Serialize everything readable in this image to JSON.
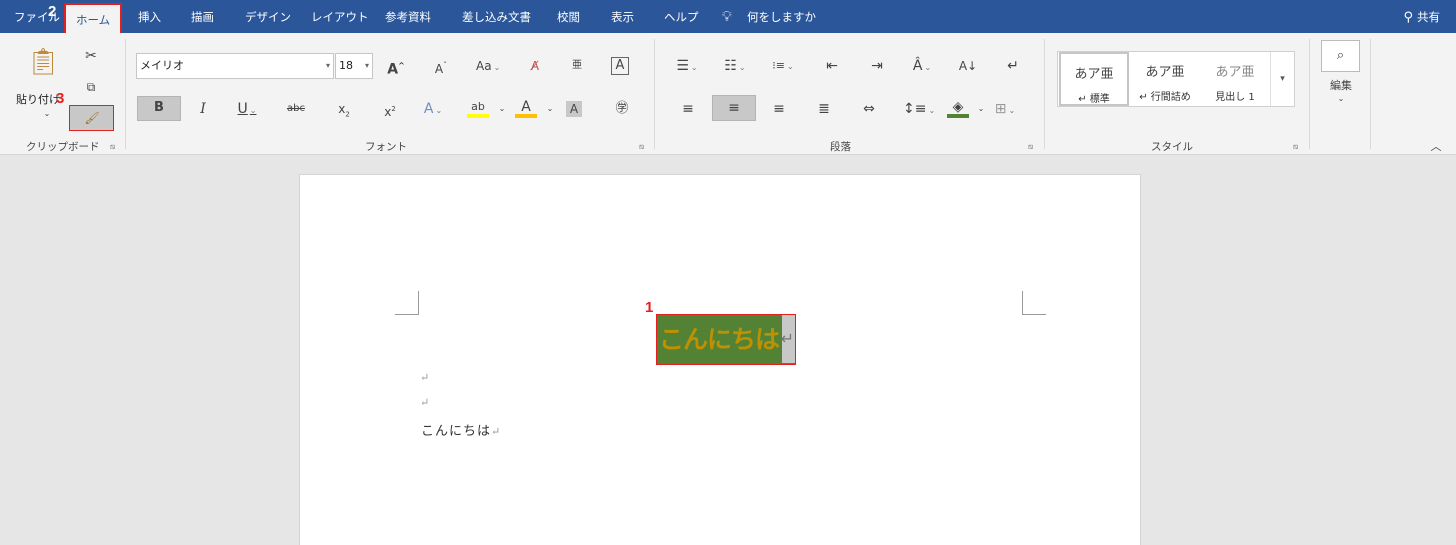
{
  "tabs": {
    "file": "ファイル",
    "home": "ホーム",
    "insert": "挿入",
    "draw": "描画",
    "design": "デザイン",
    "layout": "レイアウト",
    "references": "参考資料",
    "mailings": "差し込み文書",
    "review": "校閲",
    "view": "表示",
    "help": "ヘルプ",
    "tell_me": "何をしますか"
  },
  "share_label": "共有",
  "clipboard": {
    "paste_label": "貼り付け",
    "group_label": "クリップボード"
  },
  "font": {
    "name": "メイリオ",
    "size": "18",
    "group_label": "フォント",
    "change_case": "Aa",
    "strike": "abc"
  },
  "paragraph": {
    "group_label": "段落"
  },
  "styles": {
    "group_label": "スタイル",
    "items": [
      {
        "preview": "あア亜",
        "name": "↵ 標準"
      },
      {
        "preview": "あア亜",
        "name": "↵ 行間詰め"
      },
      {
        "preview": "あア亜",
        "name": "見出し 1"
      }
    ]
  },
  "editing": {
    "label": "編集"
  },
  "document": {
    "selected_text": "こんにちは",
    "body_text": "こんにちは"
  },
  "annotations": {
    "step1": "1",
    "step2": "2",
    "step3": "3"
  },
  "colors": {
    "accent": "#2b579a",
    "highlight": "#548235",
    "font_color": "#bf9000",
    "marker": "#e41f1f"
  }
}
